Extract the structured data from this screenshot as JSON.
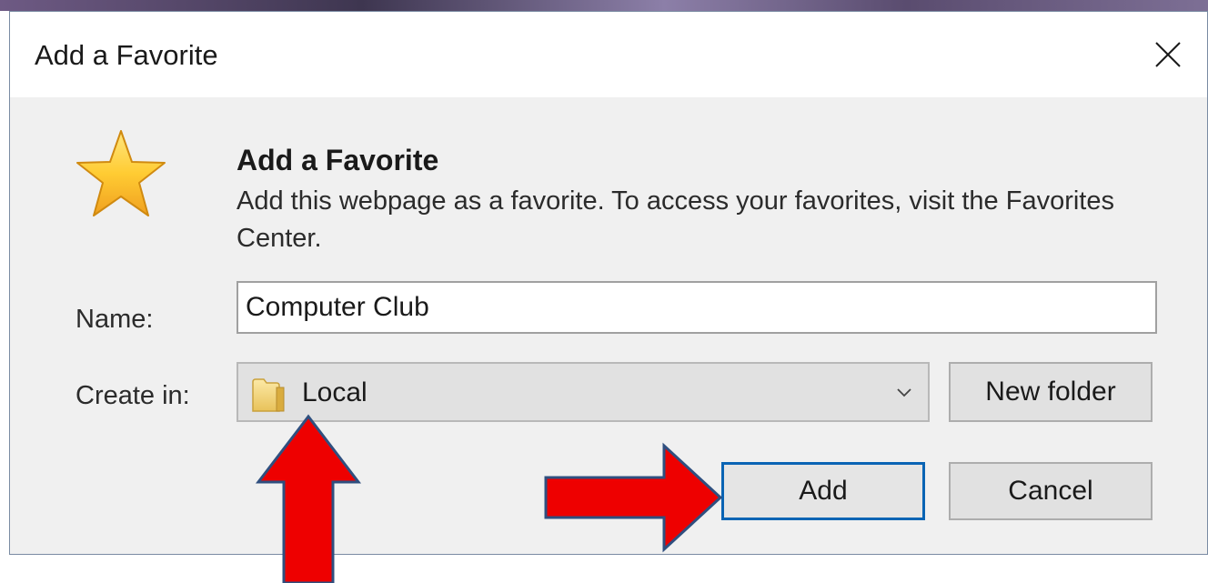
{
  "dialog": {
    "window_title": "Add a Favorite",
    "heading": "Add a Favorite",
    "description": "Add this webpage as a favorite. To access your favorites, visit the Favorites Center.",
    "close_icon": "close-icon",
    "star_icon": "star-icon"
  },
  "form": {
    "name_label": "Name:",
    "name_value": "Computer Club",
    "create_in_label": "Create in:",
    "create_in_value": "Local",
    "folder_icon": "folder-icon"
  },
  "buttons": {
    "new_folder": "New folder",
    "add": "Add",
    "cancel": "Cancel"
  },
  "annotations": {
    "arrow_color": "#ee0000",
    "arrow_outline": "#2f4f7f"
  },
  "colors": {
    "dialog_bg": "#f0f0f0",
    "titlebar_bg": "#ffffff",
    "default_button_border": "#0a64b4"
  }
}
